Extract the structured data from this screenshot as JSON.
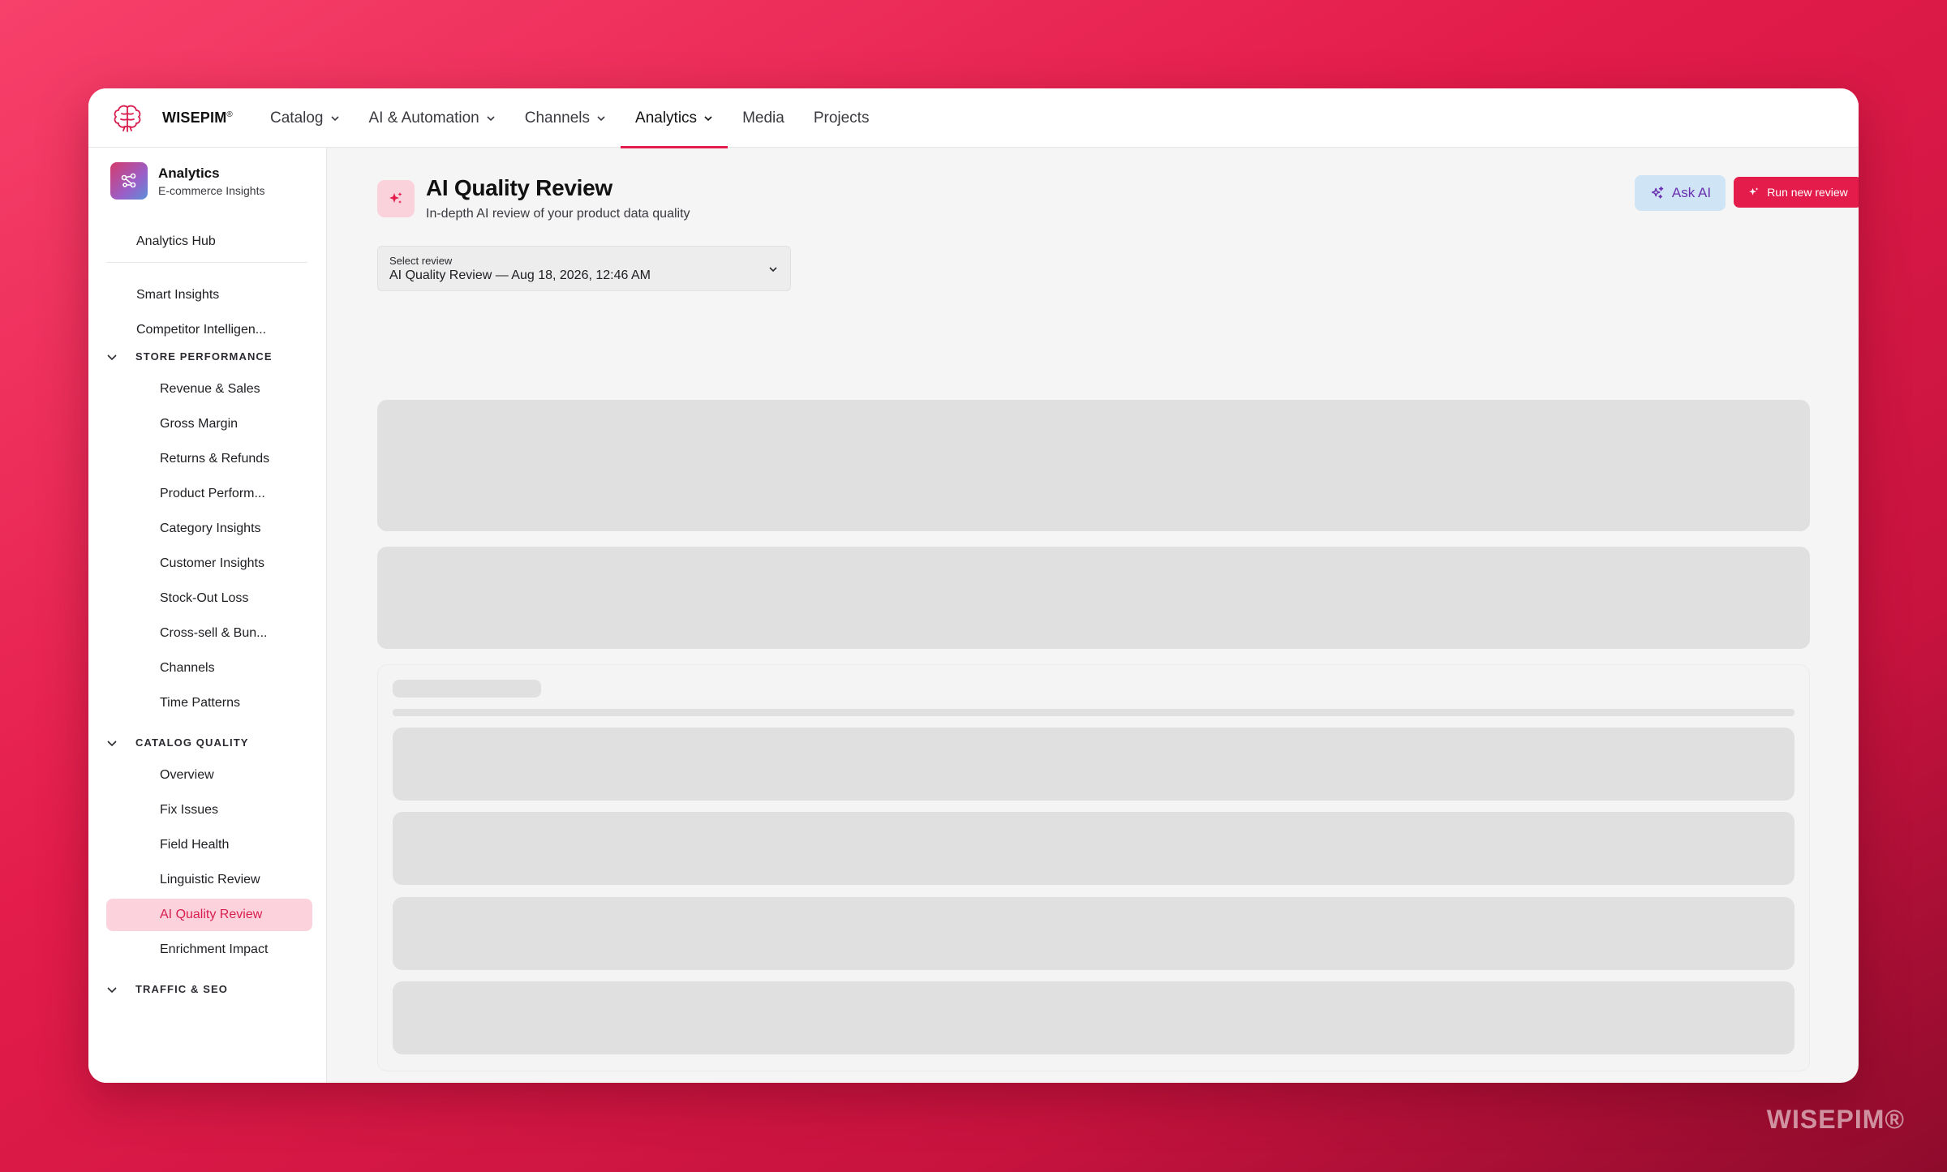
{
  "brand": {
    "name": "WISEPIM",
    "mark": "®"
  },
  "nav": {
    "items": [
      {
        "label": "Catalog",
        "dropdown": true
      },
      {
        "label": "AI & Automation",
        "dropdown": true
      },
      {
        "label": "Channels",
        "dropdown": true
      },
      {
        "label": "Analytics",
        "dropdown": true,
        "active": true
      },
      {
        "label": "Media",
        "dropdown": false
      },
      {
        "label": "Projects",
        "dropdown": false
      }
    ]
  },
  "sidebar": {
    "app_title": "Analytics",
    "app_subtitle": "E-commerce Insights",
    "hub": "Analytics Hub",
    "top_links": [
      "Smart Insights",
      "Competitor Intelligen..."
    ],
    "sections": [
      {
        "title": "STORE PERFORMANCE",
        "items": [
          "Revenue & Sales",
          "Gross Margin",
          "Returns & Refunds",
          "Product Perform...",
          "Category Insights",
          "Customer Insights",
          "Stock-Out Loss",
          "Cross-sell & Bun...",
          "Channels",
          "Time Patterns"
        ]
      },
      {
        "title": "CATALOG QUALITY",
        "items": [
          "Overview",
          "Fix Issues",
          "Field Health",
          "Linguistic Review",
          "AI Quality Review",
          "Enrichment Impact"
        ],
        "active_item": "AI Quality Review"
      },
      {
        "title": "TRAFFIC & SEO",
        "items": []
      }
    ]
  },
  "page": {
    "title": "AI Quality Review",
    "subtitle": "In-depth AI review of your product data quality",
    "ask_ai": "Ask AI",
    "run_review": "Run new review",
    "select_label": "Select review",
    "select_value": "AI Quality Review — Aug 18, 2026, 12:46 AM"
  },
  "watermark": "WISEPIM®",
  "colors": {
    "accent": "#e31c4b",
    "active_bg": "#fcd3dd",
    "ask_ai_bg": "#cfe4f4",
    "skeleton": "#e0e0e0"
  },
  "icons": {
    "logo": "brain-logo-icon",
    "app": "analytics-nodes-icon",
    "title": "sparkles-icon",
    "refresh": "refresh-icon",
    "chevron": "chevron-down-icon"
  }
}
